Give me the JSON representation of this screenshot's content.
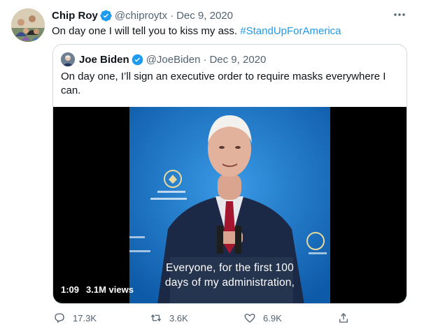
{
  "tweet": {
    "author_name": "Chip Roy",
    "author_handle": "@chiproytx",
    "separator": "·",
    "date": "Dec 9, 2020",
    "text": "On day one I will tell you to kiss my ass.",
    "hashtag": "#StandUpForAmerica",
    "more_icon": "more-horizontal-icon"
  },
  "quote": {
    "author_name": "Joe Biden",
    "author_handle": "@JoeBiden",
    "separator": "·",
    "date": "Dec 9, 2020",
    "text": "On day one, I’ll sign an executive order to require masks everywhere I can.",
    "video": {
      "caption_line1": "Everyone, for the first 100",
      "caption_line2": "days of my administration,",
      "duration": "1:09",
      "views": "3.1M views"
    }
  },
  "actions": {
    "replies": "17.3K",
    "retweets": "3.6K",
    "likes": "6.9K"
  },
  "colors": {
    "accent": "#1d9bf0",
    "muted": "#536471",
    "border": "#cfd9de",
    "video_background": "#1a78c8"
  }
}
